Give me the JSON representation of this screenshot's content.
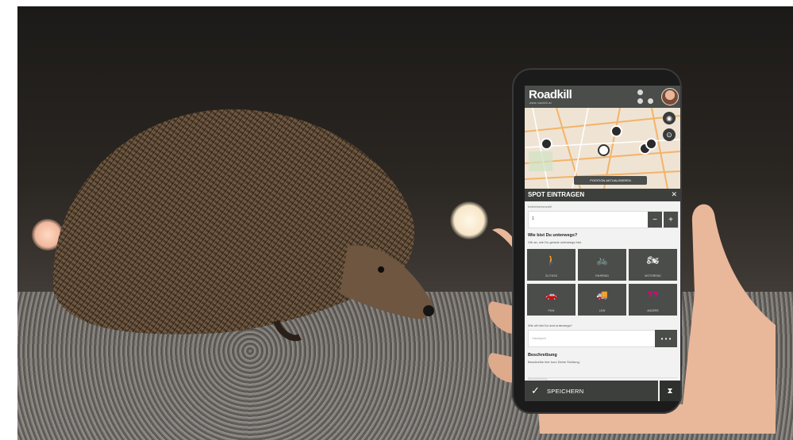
{
  "app": {
    "logo": "Roadkill",
    "logo_sub": "www.roadkill.at"
  },
  "map": {
    "position_button": "POSITION AKTUALISIEREN"
  },
  "form": {
    "title": "SPOT EINTRAGEN",
    "count_label": "Individuenanzahl",
    "count_value": "1",
    "minus": "−",
    "plus": "+",
    "travel_question": "Wie bist Du unterwegs?",
    "travel_hint": "Gib an, wie Du gerade unterwegs bist.",
    "modes": [
      {
        "label": "ZU FUSS",
        "icon": "walking-icon",
        "glyph": "🚶"
      },
      {
        "label": "FAHRRAD",
        "icon": "bicycle-icon",
        "glyph": "🚲"
      },
      {
        "label": "MOTORRAD",
        "icon": "motorcycle-icon",
        "glyph": "🏍"
      },
      {
        "label": "PKW",
        "icon": "car-icon",
        "glyph": "🚗"
      },
      {
        "label": "LKW",
        "icon": "truck-icon",
        "glyph": "🚚"
      },
      {
        "label": "ANDERE",
        "icon": "question-icon",
        "glyph": "??"
      }
    ],
    "frequency_question": "Wie oft bist Du dort unterwegs?",
    "frequency_placeholder": "Häufigkeit",
    "frequency_more": "• • •",
    "description_title": "Beschreibung",
    "description_hint": "Beschreibe hier kurz Deine Sichtung.",
    "description_placeholder": "Beschreibung",
    "save_label": "SPEICHERN",
    "save_check": "✓",
    "hourglass": "⧗",
    "close": "✕"
  },
  "colors": {
    "header": "#4a4d49",
    "bar": "#3c3f3b",
    "accent": "#e4007f"
  }
}
